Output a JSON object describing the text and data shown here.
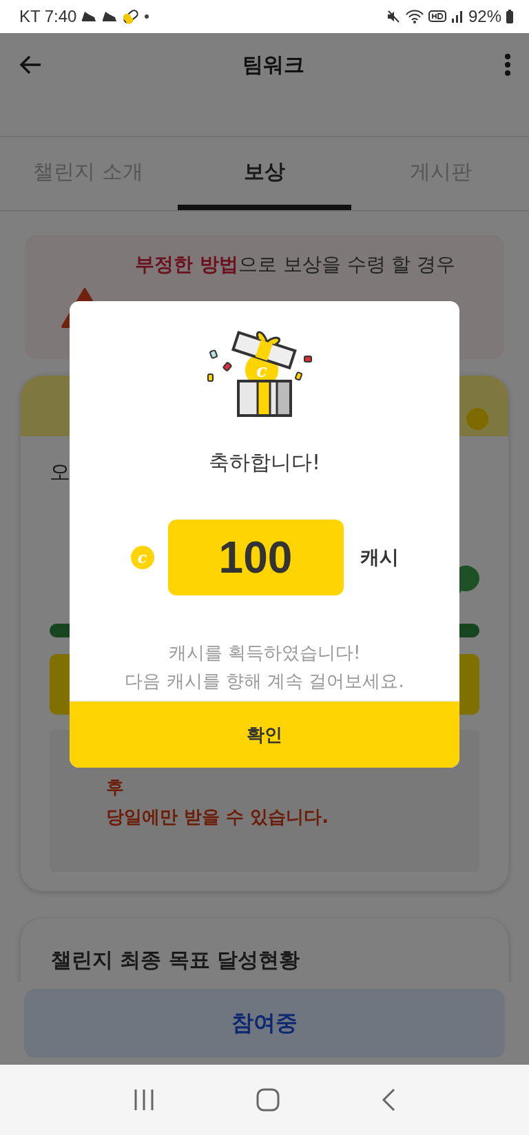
{
  "status_bar": {
    "carrier": "KT",
    "time": "7:40",
    "battery": "92%"
  },
  "app_bar": {
    "title": "팀워크"
  },
  "tabs": [
    {
      "label": "챌린지 소개",
      "selected": false
    },
    {
      "label": "보상",
      "selected": true
    },
    {
      "label": "게시판",
      "selected": false
    }
  ],
  "warning": {
    "lines": [
      "**부정한 방법**으로 보상을 수령 할 경우"
    ]
  },
  "reward_card": {
    "heading": "오",
    "progress": {
      "level": 1
    },
    "notice_lines": [
      "후",
      "당일에만 받을 수 있습니다."
    ]
  },
  "goal_card": {
    "title": "챌린지 최종 목표 달성현황"
  },
  "join_button": {
    "label": "참여중"
  },
  "dialog": {
    "title": "축하합니다!",
    "gift_coin_symbol": "c",
    "coin_symbol": "c",
    "amount": "100",
    "unit": "캐시",
    "message": [
      "캐시를 획득하였습니다!",
      "다음 캐시를 향해 계속 걸어보세요."
    ],
    "confirm": "확인"
  }
}
